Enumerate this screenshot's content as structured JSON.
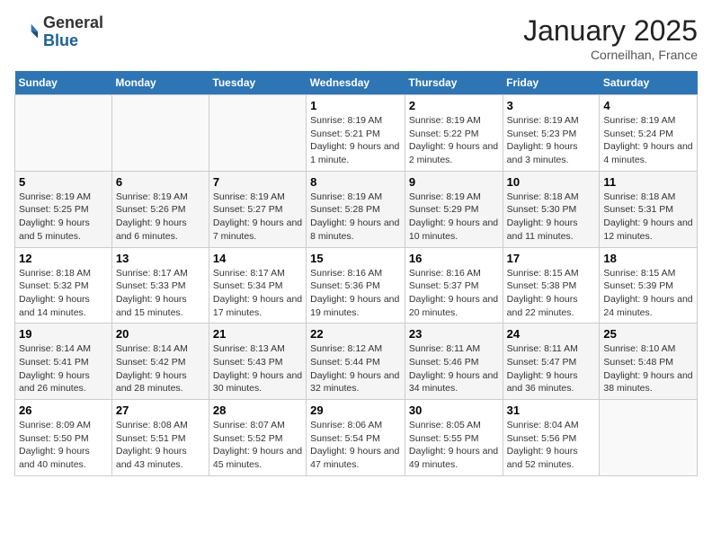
{
  "header": {
    "logo_general": "General",
    "logo_blue": "Blue",
    "month_title": "January 2025",
    "location": "Corneilhan, France"
  },
  "weekdays": [
    "Sunday",
    "Monday",
    "Tuesday",
    "Wednesday",
    "Thursday",
    "Friday",
    "Saturday"
  ],
  "weeks": [
    [
      {
        "day": "",
        "sunrise": "",
        "sunset": "",
        "daylight": ""
      },
      {
        "day": "",
        "sunrise": "",
        "sunset": "",
        "daylight": ""
      },
      {
        "day": "",
        "sunrise": "",
        "sunset": "",
        "daylight": ""
      },
      {
        "day": "1",
        "sunrise": "Sunrise: 8:19 AM",
        "sunset": "Sunset: 5:21 PM",
        "daylight": "Daylight: 9 hours and 1 minute."
      },
      {
        "day": "2",
        "sunrise": "Sunrise: 8:19 AM",
        "sunset": "Sunset: 5:22 PM",
        "daylight": "Daylight: 9 hours and 2 minutes."
      },
      {
        "day": "3",
        "sunrise": "Sunrise: 8:19 AM",
        "sunset": "Sunset: 5:23 PM",
        "daylight": "Daylight: 9 hours and 3 minutes."
      },
      {
        "day": "4",
        "sunrise": "Sunrise: 8:19 AM",
        "sunset": "Sunset: 5:24 PM",
        "daylight": "Daylight: 9 hours and 4 minutes."
      }
    ],
    [
      {
        "day": "5",
        "sunrise": "Sunrise: 8:19 AM",
        "sunset": "Sunset: 5:25 PM",
        "daylight": "Daylight: 9 hours and 5 minutes."
      },
      {
        "day": "6",
        "sunrise": "Sunrise: 8:19 AM",
        "sunset": "Sunset: 5:26 PM",
        "daylight": "Daylight: 9 hours and 6 minutes."
      },
      {
        "day": "7",
        "sunrise": "Sunrise: 8:19 AM",
        "sunset": "Sunset: 5:27 PM",
        "daylight": "Daylight: 9 hours and 7 minutes."
      },
      {
        "day": "8",
        "sunrise": "Sunrise: 8:19 AM",
        "sunset": "Sunset: 5:28 PM",
        "daylight": "Daylight: 9 hours and 8 minutes."
      },
      {
        "day": "9",
        "sunrise": "Sunrise: 8:19 AM",
        "sunset": "Sunset: 5:29 PM",
        "daylight": "Daylight: 9 hours and 10 minutes."
      },
      {
        "day": "10",
        "sunrise": "Sunrise: 8:18 AM",
        "sunset": "Sunset: 5:30 PM",
        "daylight": "Daylight: 9 hours and 11 minutes."
      },
      {
        "day": "11",
        "sunrise": "Sunrise: 8:18 AM",
        "sunset": "Sunset: 5:31 PM",
        "daylight": "Daylight: 9 hours and 12 minutes."
      }
    ],
    [
      {
        "day": "12",
        "sunrise": "Sunrise: 8:18 AM",
        "sunset": "Sunset: 5:32 PM",
        "daylight": "Daylight: 9 hours and 14 minutes."
      },
      {
        "day": "13",
        "sunrise": "Sunrise: 8:17 AM",
        "sunset": "Sunset: 5:33 PM",
        "daylight": "Daylight: 9 hours and 15 minutes."
      },
      {
        "day": "14",
        "sunrise": "Sunrise: 8:17 AM",
        "sunset": "Sunset: 5:34 PM",
        "daylight": "Daylight: 9 hours and 17 minutes."
      },
      {
        "day": "15",
        "sunrise": "Sunrise: 8:16 AM",
        "sunset": "Sunset: 5:36 PM",
        "daylight": "Daylight: 9 hours and 19 minutes."
      },
      {
        "day": "16",
        "sunrise": "Sunrise: 8:16 AM",
        "sunset": "Sunset: 5:37 PM",
        "daylight": "Daylight: 9 hours and 20 minutes."
      },
      {
        "day": "17",
        "sunrise": "Sunrise: 8:15 AM",
        "sunset": "Sunset: 5:38 PM",
        "daylight": "Daylight: 9 hours and 22 minutes."
      },
      {
        "day": "18",
        "sunrise": "Sunrise: 8:15 AM",
        "sunset": "Sunset: 5:39 PM",
        "daylight": "Daylight: 9 hours and 24 minutes."
      }
    ],
    [
      {
        "day": "19",
        "sunrise": "Sunrise: 8:14 AM",
        "sunset": "Sunset: 5:41 PM",
        "daylight": "Daylight: 9 hours and 26 minutes."
      },
      {
        "day": "20",
        "sunrise": "Sunrise: 8:14 AM",
        "sunset": "Sunset: 5:42 PM",
        "daylight": "Daylight: 9 hours and 28 minutes."
      },
      {
        "day": "21",
        "sunrise": "Sunrise: 8:13 AM",
        "sunset": "Sunset: 5:43 PM",
        "daylight": "Daylight: 9 hours and 30 minutes."
      },
      {
        "day": "22",
        "sunrise": "Sunrise: 8:12 AM",
        "sunset": "Sunset: 5:44 PM",
        "daylight": "Daylight: 9 hours and 32 minutes."
      },
      {
        "day": "23",
        "sunrise": "Sunrise: 8:11 AM",
        "sunset": "Sunset: 5:46 PM",
        "daylight": "Daylight: 9 hours and 34 minutes."
      },
      {
        "day": "24",
        "sunrise": "Sunrise: 8:11 AM",
        "sunset": "Sunset: 5:47 PM",
        "daylight": "Daylight: 9 hours and 36 minutes."
      },
      {
        "day": "25",
        "sunrise": "Sunrise: 8:10 AM",
        "sunset": "Sunset: 5:48 PM",
        "daylight": "Daylight: 9 hours and 38 minutes."
      }
    ],
    [
      {
        "day": "26",
        "sunrise": "Sunrise: 8:09 AM",
        "sunset": "Sunset: 5:50 PM",
        "daylight": "Daylight: 9 hours and 40 minutes."
      },
      {
        "day": "27",
        "sunrise": "Sunrise: 8:08 AM",
        "sunset": "Sunset: 5:51 PM",
        "daylight": "Daylight: 9 hours and 43 minutes."
      },
      {
        "day": "28",
        "sunrise": "Sunrise: 8:07 AM",
        "sunset": "Sunset: 5:52 PM",
        "daylight": "Daylight: 9 hours and 45 minutes."
      },
      {
        "day": "29",
        "sunrise": "Sunrise: 8:06 AM",
        "sunset": "Sunset: 5:54 PM",
        "daylight": "Daylight: 9 hours and 47 minutes."
      },
      {
        "day": "30",
        "sunrise": "Sunrise: 8:05 AM",
        "sunset": "Sunset: 5:55 PM",
        "daylight": "Daylight: 9 hours and 49 minutes."
      },
      {
        "day": "31",
        "sunrise": "Sunrise: 8:04 AM",
        "sunset": "Sunset: 5:56 PM",
        "daylight": "Daylight: 9 hours and 52 minutes."
      },
      {
        "day": "",
        "sunrise": "",
        "sunset": "",
        "daylight": ""
      }
    ]
  ]
}
